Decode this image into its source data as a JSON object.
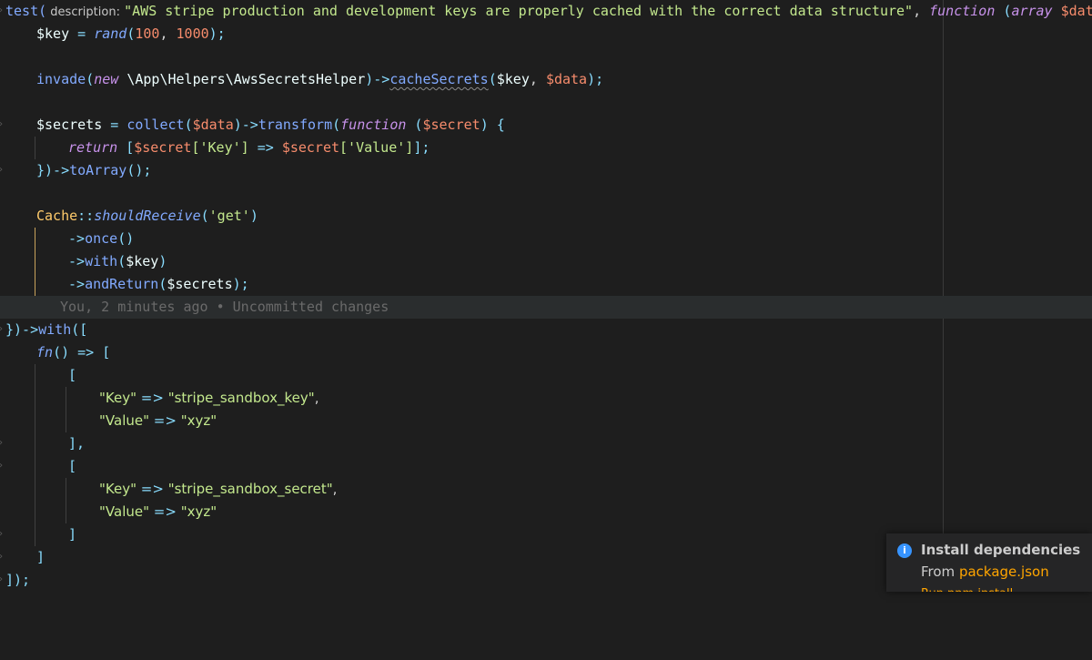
{
  "editor": {
    "lines": {
      "l1": {
        "test": "test(",
        "hint": "description:",
        "desc": "\"AWS stripe production and development keys are properly cached with the correct data structure\"",
        "comma": ",",
        "function_kw": "function",
        "paren_open": "(",
        "array_kw": "array",
        "data_param": "$data",
        "tail": "){"
      },
      "l2": {
        "key_var": "$key",
        "eq": " = ",
        "rand": "rand",
        "po": "(",
        "n1": "100",
        "sep": ", ",
        "n2": "1000",
        "pc": ");"
      },
      "l4": {
        "invade": "invade",
        "po": "(",
        "new_kw": "new",
        "cls": "\\App\\Helpers\\AwsSecretsHelper",
        "arrow": ")->",
        "method": "cacheSecrets",
        "args_open": "(",
        "key_var": "$key",
        "sep": ", ",
        "data_param": "$data",
        "close": ");"
      },
      "l6": {
        "secrets_var": "$secrets",
        "eq": " = ",
        "collect": "collect",
        "po": "(",
        "data_param": "$data",
        "arrow": ")->",
        "transform": "transform",
        "po2": "(",
        "function_kw": "function",
        "p1": " (",
        "secret_param": "$secret",
        "tail": ") {"
      },
      "l7": {
        "return_kw": "return",
        "b1": " [",
        "secret1": "$secret",
        "k1": "['Key']",
        "arrow": " => ",
        "secret2": "$secret",
        "k2": "['Value']",
        "tail": "];"
      },
      "l8": {
        "close": "})->",
        "toarray": "toArray",
        "tail": "();"
      },
      "l10": {
        "cache": "Cache",
        "dc": "::",
        "should": "shouldReceive",
        "po": "(",
        "get": "'get'",
        "pc": ")"
      },
      "l11": {
        "arrow": "->",
        "once": "once",
        "tail": "()"
      },
      "l12": {
        "arrow": "->",
        "with": "with",
        "po": "(",
        "key_var": "$key",
        "pc": ")"
      },
      "l13": {
        "arrow": "->",
        "andreturn": "andReturn",
        "po": "(",
        "secrets_var": "$secrets",
        "pc": ");"
      },
      "l14": {
        "blame": "You, 2 minutes ago • Uncommitted changes"
      },
      "l15": {
        "close": "})->",
        "with": "with",
        "tail": "(["
      },
      "l16": {
        "fn": "fn",
        "tail": "() => ["
      },
      "l17": {
        "b": "["
      },
      "l18": {
        "k": "\"Key\"",
        "arrow": " => ",
        "v": "\"stripe_sandbox_key\"",
        "c": ","
      },
      "l19": {
        "k": "\"Value\"",
        "arrow": " => ",
        "v": "\"xyz\""
      },
      "l20": {
        "b": "],"
      },
      "l21": {
        "b": "["
      },
      "l22": {
        "k": "\"Key\"",
        "arrow": " => ",
        "v": "\"stripe_sandbox_secret\"",
        "c": ","
      },
      "l23": {
        "k": "\"Value\"",
        "arrow": " => ",
        "v": "\"xyz\""
      },
      "l24": {
        "b": "]"
      },
      "l25": {
        "b": "]"
      },
      "l26": {
        "b": "]);"
      }
    }
  },
  "notification": {
    "icon": "info-icon",
    "title": "Install dependencies",
    "from_prefix": "From ",
    "from_link": "package.json",
    "action_text": "Run npm install"
  },
  "colors": {
    "background": "#1e1e1e",
    "function": "#82aaff",
    "keyword": "#c792ea",
    "string": "#c3e88d",
    "variable_param": "#f78c6c",
    "class": "#ffcb6b",
    "notification_link": "#ffa500",
    "info_icon": "#3794ff"
  }
}
